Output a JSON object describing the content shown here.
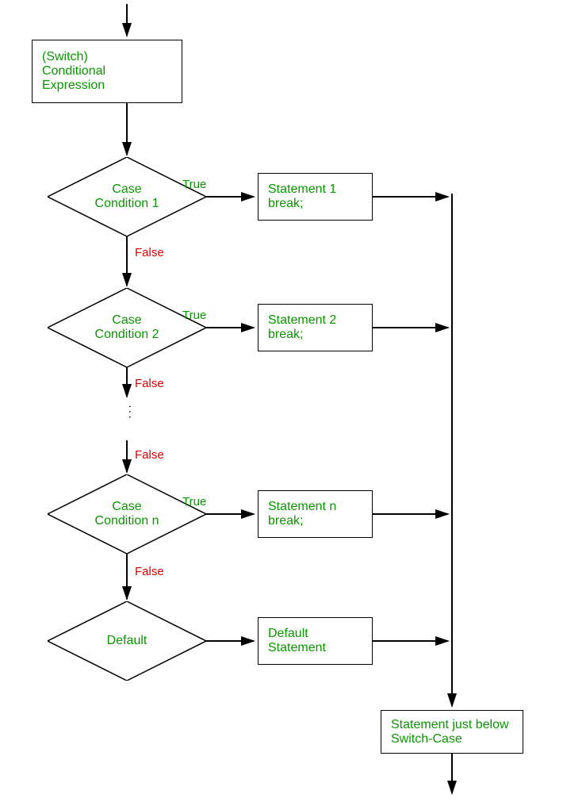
{
  "start": {
    "line1": "(Switch)",
    "line2": "Conditional",
    "line3": "Expression"
  },
  "cases": [
    {
      "cond_line1": "Case",
      "cond_line2": "Condition 1",
      "stmt_line1": "Statement 1",
      "stmt_line2": "break;"
    },
    {
      "cond_line1": "Case",
      "cond_line2": "Condition 2",
      "stmt_line1": "Statement 2",
      "stmt_line2": "break;"
    },
    {
      "cond_line1": "Case",
      "cond_line2": "Condition n",
      "stmt_line1": "Statement n",
      "stmt_line2": "break;"
    }
  ],
  "default": {
    "cond": "Default",
    "stmt_line1": "Default",
    "stmt_line2": "Statement"
  },
  "end": "Statement just below\nSwitch-Case",
  "labels": {
    "true": "True",
    "false": "False"
  }
}
